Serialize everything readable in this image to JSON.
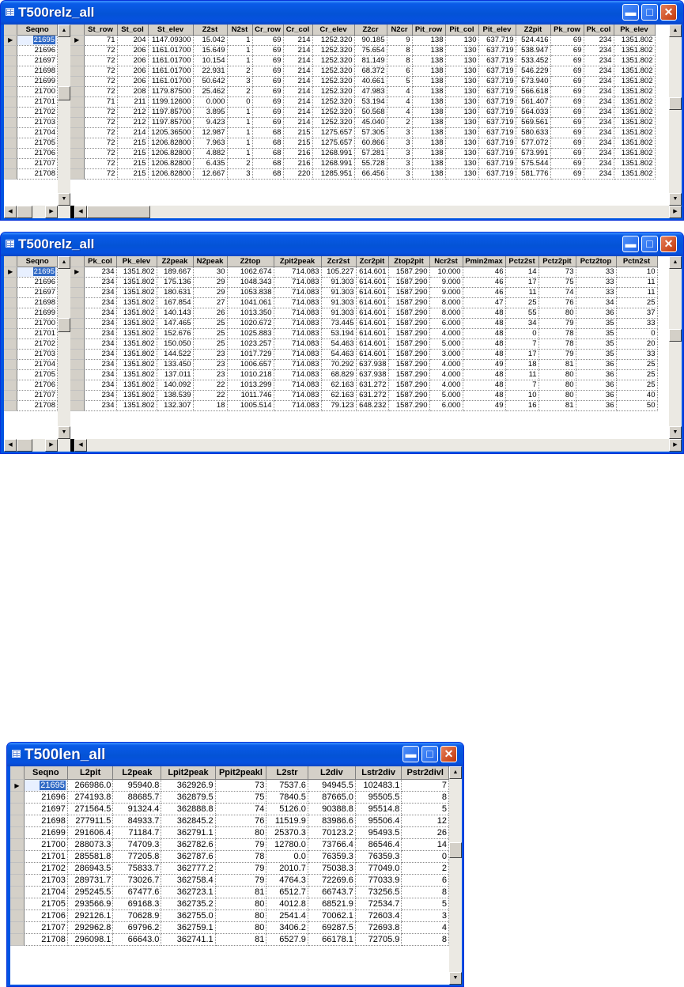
{
  "windows": [
    {
      "title": "T500relz_all",
      "key_column": "Seqno",
      "columns": [
        "St_row",
        "St_col",
        "St_elev",
        "Z2st",
        "N2st",
        "Cr_row",
        "Cr_col",
        "Cr_elev",
        "Z2cr",
        "N2cr",
        "Pit_row",
        "Pit_col",
        "Pit_elev",
        "Z2pit",
        "Pk_row",
        "Pk_col",
        "Pk_elev"
      ],
      "rows": [
        {
          "seqno": "21695",
          "cells": [
            "71",
            "204",
            "1147.09300",
            "15.042",
            "1",
            "69",
            "214",
            "1252.320",
            "90.185",
            "9",
            "138",
            "130",
            "637.719",
            "524.416",
            "69",
            "234",
            "1351.802"
          ]
        },
        {
          "seqno": "21696",
          "cells": [
            "72",
            "206",
            "1161.01700",
            "15.649",
            "1",
            "69",
            "214",
            "1252.320",
            "75.654",
            "8",
            "138",
            "130",
            "637.719",
            "538.947",
            "69",
            "234",
            "1351.802"
          ]
        },
        {
          "seqno": "21697",
          "cells": [
            "72",
            "206",
            "1161.01700",
            "10.154",
            "1",
            "69",
            "214",
            "1252.320",
            "81.149",
            "8",
            "138",
            "130",
            "637.719",
            "533.452",
            "69",
            "234",
            "1351.802"
          ]
        },
        {
          "seqno": "21698",
          "cells": [
            "72",
            "206",
            "1161.01700",
            "22.931",
            "2",
            "69",
            "214",
            "1252.320",
            "68.372",
            "6",
            "138",
            "130",
            "637.719",
            "546.229",
            "69",
            "234",
            "1351.802"
          ]
        },
        {
          "seqno": "21699",
          "cells": [
            "72",
            "206",
            "1161.01700",
            "50.642",
            "3",
            "69",
            "214",
            "1252.320",
            "40.661",
            "5",
            "138",
            "130",
            "637.719",
            "573.940",
            "69",
            "234",
            "1351.802"
          ]
        },
        {
          "seqno": "21700",
          "cells": [
            "72",
            "208",
            "1179.87500",
            "25.462",
            "2",
            "69",
            "214",
            "1252.320",
            "47.983",
            "4",
            "138",
            "130",
            "637.719",
            "566.618",
            "69",
            "234",
            "1351.802"
          ]
        },
        {
          "seqno": "21701",
          "cells": [
            "71",
            "211",
            "1199.12600",
            "0.000",
            "0",
            "69",
            "214",
            "1252.320",
            "53.194",
            "4",
            "138",
            "130",
            "637.719",
            "561.407",
            "69",
            "234",
            "1351.802"
          ]
        },
        {
          "seqno": "21702",
          "cells": [
            "72",
            "212",
            "1197.85700",
            "3.895",
            "1",
            "69",
            "214",
            "1252.320",
            "50.568",
            "4",
            "138",
            "130",
            "637.719",
            "564.033",
            "69",
            "234",
            "1351.802"
          ]
        },
        {
          "seqno": "21703",
          "cells": [
            "72",
            "212",
            "1197.85700",
            "9.423",
            "1",
            "69",
            "214",
            "1252.320",
            "45.040",
            "2",
            "138",
            "130",
            "637.719",
            "569.561",
            "69",
            "234",
            "1351.802"
          ]
        },
        {
          "seqno": "21704",
          "cells": [
            "72",
            "214",
            "1205.36500",
            "12.987",
            "1",
            "68",
            "215",
            "1275.657",
            "57.305",
            "3",
            "138",
            "130",
            "637.719",
            "580.633",
            "69",
            "234",
            "1351.802"
          ]
        },
        {
          "seqno": "21705",
          "cells": [
            "72",
            "215",
            "1206.82800",
            "7.963",
            "1",
            "68",
            "215",
            "1275.657",
            "60.866",
            "3",
            "138",
            "130",
            "637.719",
            "577.072",
            "69",
            "234",
            "1351.802"
          ]
        },
        {
          "seqno": "21706",
          "cells": [
            "72",
            "215",
            "1206.82800",
            "4.882",
            "1",
            "68",
            "216",
            "1268.991",
            "57.281",
            "3",
            "138",
            "130",
            "637.719",
            "573.991",
            "69",
            "234",
            "1351.802"
          ]
        },
        {
          "seqno": "21707",
          "cells": [
            "72",
            "215",
            "1206.82800",
            "6.435",
            "2",
            "68",
            "216",
            "1268.991",
            "55.728",
            "3",
            "138",
            "130",
            "637.719",
            "575.544",
            "69",
            "234",
            "1351.802"
          ]
        },
        {
          "seqno": "21708",
          "cells": [
            "72",
            "215",
            "1206.82800",
            "12.667",
            "3",
            "68",
            "220",
            "1285.951",
            "66.456",
            "3",
            "138",
            "130",
            "637.719",
            "581.776",
            "69",
            "234",
            "1351.802"
          ]
        }
      ]
    },
    {
      "title": "T500relz_all",
      "key_column": "Seqno",
      "columns": [
        "Pk_col",
        "Pk_elev",
        "Z2peak",
        "N2peak",
        "Z2top",
        "Zpit2peak",
        "Zcr2st",
        "Zcr2pit",
        "Ztop2pit",
        "Ncr2st",
        "Pmin2max",
        "Pctz2st",
        "Pctz2pit",
        "Pctz2top",
        "Pctn2st"
      ],
      "rows": [
        {
          "seqno": "21695",
          "cells": [
            "234",
            "1351.802",
            "189.667",
            "30",
            "1062.674",
            "714.083",
            "105.227",
            "614.601",
            "1587.290",
            "10.000",
            "46",
            "14",
            "73",
            "33",
            "10"
          ]
        },
        {
          "seqno": "21696",
          "cells": [
            "234",
            "1351.802",
            "175.136",
            "29",
            "1048.343",
            "714.083",
            "91.303",
            "614.601",
            "1587.290",
            "9.000",
            "46",
            "17",
            "75",
            "33",
            "11"
          ]
        },
        {
          "seqno": "21697",
          "cells": [
            "234",
            "1351.802",
            "180.631",
            "29",
            "1053.838",
            "714.083",
            "91.303",
            "614.601",
            "1587.290",
            "9.000",
            "46",
            "11",
            "74",
            "33",
            "11"
          ]
        },
        {
          "seqno": "21698",
          "cells": [
            "234",
            "1351.802",
            "167.854",
            "27",
            "1041.061",
            "714.083",
            "91.303",
            "614.601",
            "1587.290",
            "8.000",
            "47",
            "25",
            "76",
            "34",
            "25"
          ]
        },
        {
          "seqno": "21699",
          "cells": [
            "234",
            "1351.802",
            "140.143",
            "26",
            "1013.350",
            "714.083",
            "91.303",
            "614.601",
            "1587.290",
            "8.000",
            "48",
            "55",
            "80",
            "36",
            "37"
          ]
        },
        {
          "seqno": "21700",
          "cells": [
            "234",
            "1351.802",
            "147.465",
            "25",
            "1020.672",
            "714.083",
            "73.445",
            "614.601",
            "1587.290",
            "6.000",
            "48",
            "34",
            "79",
            "35",
            "33"
          ]
        },
        {
          "seqno": "21701",
          "cells": [
            "234",
            "1351.802",
            "152.676",
            "25",
            "1025.883",
            "714.083",
            "53.194",
            "614.601",
            "1587.290",
            "4.000",
            "48",
            "0",
            "78",
            "35",
            "0"
          ]
        },
        {
          "seqno": "21702",
          "cells": [
            "234",
            "1351.802",
            "150.050",
            "25",
            "1023.257",
            "714.083",
            "54.463",
            "614.601",
            "1587.290",
            "5.000",
            "48",
            "7",
            "78",
            "35",
            "20"
          ]
        },
        {
          "seqno": "21703",
          "cells": [
            "234",
            "1351.802",
            "144.522",
            "23",
            "1017.729",
            "714.083",
            "54.463",
            "614.601",
            "1587.290",
            "3.000",
            "48",
            "17",
            "79",
            "35",
            "33"
          ]
        },
        {
          "seqno": "21704",
          "cells": [
            "234",
            "1351.802",
            "133.450",
            "23",
            "1006.657",
            "714.083",
            "70.292",
            "637.938",
            "1587.290",
            "4.000",
            "49",
            "18",
            "81",
            "36",
            "25"
          ]
        },
        {
          "seqno": "21705",
          "cells": [
            "234",
            "1351.802",
            "137.011",
            "23",
            "1010.218",
            "714.083",
            "68.829",
            "637.938",
            "1587.290",
            "4.000",
            "48",
            "11",
            "80",
            "36",
            "25"
          ]
        },
        {
          "seqno": "21706",
          "cells": [
            "234",
            "1351.802",
            "140.092",
            "22",
            "1013.299",
            "714.083",
            "62.163",
            "631.272",
            "1587.290",
            "4.000",
            "48",
            "7",
            "80",
            "36",
            "25"
          ]
        },
        {
          "seqno": "21707",
          "cells": [
            "234",
            "1351.802",
            "138.539",
            "22",
            "1011.746",
            "714.083",
            "62.163",
            "631.272",
            "1587.290",
            "5.000",
            "48",
            "10",
            "80",
            "36",
            "40"
          ]
        },
        {
          "seqno": "21708",
          "cells": [
            "234",
            "1351.802",
            "132.307",
            "18",
            "1005.514",
            "714.083",
            "79.123",
            "648.232",
            "1587.290",
            "6.000",
            "49",
            "16",
            "81",
            "36",
            "50"
          ]
        }
      ]
    },
    {
      "title": "T500len_all",
      "key_column": "Seqno",
      "columns": [
        "L2pit",
        "L2peak",
        "Lpit2peak",
        "Ppit2peakl",
        "L2str",
        "L2div",
        "Lstr2div",
        "Pstr2divl"
      ],
      "rows": [
        {
          "seqno": "21695",
          "cells": [
            "266986.0",
            "95940.8",
            "362926.9",
            "73",
            "7537.6",
            "94945.5",
            "102483.1",
            "7"
          ]
        },
        {
          "seqno": "21696",
          "cells": [
            "274193.8",
            "88685.7",
            "362879.5",
            "75",
            "7840.5",
            "87665.0",
            "95505.5",
            "8"
          ]
        },
        {
          "seqno": "21697",
          "cells": [
            "271564.5",
            "91324.4",
            "362888.8",
            "74",
            "5126.0",
            "90388.8",
            "95514.8",
            "5"
          ]
        },
        {
          "seqno": "21698",
          "cells": [
            "277911.5",
            "84933.7",
            "362845.2",
            "76",
            "11519.9",
            "83986.6",
            "95506.4",
            "12"
          ]
        },
        {
          "seqno": "21699",
          "cells": [
            "291606.4",
            "71184.7",
            "362791.1",
            "80",
            "25370.3",
            "70123.2",
            "95493.5",
            "26"
          ]
        },
        {
          "seqno": "21700",
          "cells": [
            "288073.3",
            "74709.3",
            "362782.6",
            "79",
            "12780.0",
            "73766.4",
            "86546.4",
            "14"
          ]
        },
        {
          "seqno": "21701",
          "cells": [
            "285581.8",
            "77205.8",
            "362787.6",
            "78",
            "0.0",
            "76359.3",
            "76359.3",
            "0"
          ]
        },
        {
          "seqno": "21702",
          "cells": [
            "286943.5",
            "75833.7",
            "362777.2",
            "79",
            "2010.7",
            "75038.3",
            "77049.0",
            "2"
          ]
        },
        {
          "seqno": "21703",
          "cells": [
            "289731.7",
            "73026.7",
            "362758.4",
            "79",
            "4764.3",
            "72269.6",
            "77033.9",
            "6"
          ]
        },
        {
          "seqno": "21704",
          "cells": [
            "295245.5",
            "67477.6",
            "362723.1",
            "81",
            "6512.7",
            "66743.7",
            "73256.5",
            "8"
          ]
        },
        {
          "seqno": "21705",
          "cells": [
            "293566.9",
            "69168.3",
            "362735.2",
            "80",
            "4012.8",
            "68521.9",
            "72534.7",
            "5"
          ]
        },
        {
          "seqno": "21706",
          "cells": [
            "292126.1",
            "70628.9",
            "362755.0",
            "80",
            "2541.4",
            "70062.1",
            "72603.4",
            "3"
          ]
        },
        {
          "seqno": "21707",
          "cells": [
            "292962.8",
            "69796.2",
            "362759.1",
            "80",
            "3406.2",
            "69287.5",
            "72693.8",
            "4"
          ]
        },
        {
          "seqno": "21708",
          "cells": [
            "296098.1",
            "66643.0",
            "362741.1",
            "81",
            "6527.9",
            "66178.1",
            "72705.9",
            "8"
          ]
        }
      ]
    }
  ],
  "icons": {
    "window": "table-icon",
    "minimize": "minimize-icon",
    "maximize": "maximize-icon",
    "close": "close-icon",
    "current_row": "current-row-arrow-icon"
  },
  "colors": {
    "titlebar": "#0a5be8",
    "close_button": "#c2380a",
    "selection": "#316ac5"
  }
}
